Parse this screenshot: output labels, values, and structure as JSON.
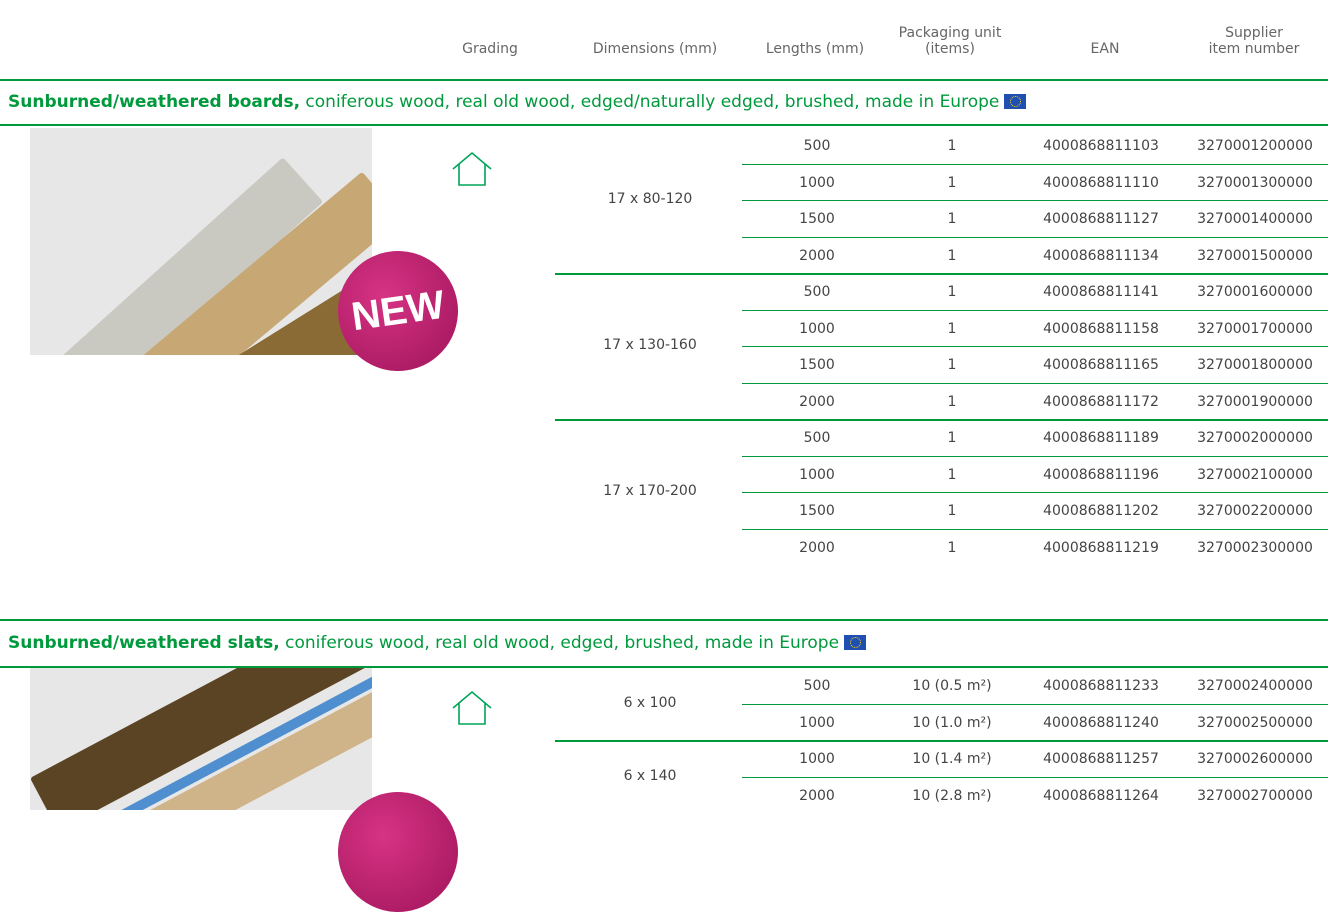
{
  "header": {
    "grading": "Grading",
    "dimensions": "Dimensions (mm)",
    "lengths": "Lengths (mm)",
    "packaging_line1": "Packaging unit",
    "packaging_line2": "(items)",
    "ean": "EAN",
    "supplier_line1": "Supplier",
    "supplier_line2": "item number"
  },
  "sections": [
    {
      "title_bold": "Sunburned/weathered boards,",
      "title_rest": " coniferous wood, real old wood, edged/naturally edged, brushed, made in Europe",
      "badge": "NEW",
      "groups": [
        {
          "dimension": "17 x 80-120",
          "rows": [
            {
              "length": "500",
              "pack": "1",
              "ean": "4000868811103",
              "supplier": "3270001200000"
            },
            {
              "length": "1000",
              "pack": "1",
              "ean": "4000868811110",
              "supplier": "3270001300000"
            },
            {
              "length": "1500",
              "pack": "1",
              "ean": "4000868811127",
              "supplier": "3270001400000"
            },
            {
              "length": "2000",
              "pack": "1",
              "ean": "4000868811134",
              "supplier": "3270001500000"
            }
          ]
        },
        {
          "dimension": "17 x 130-160",
          "rows": [
            {
              "length": "500",
              "pack": "1",
              "ean": "4000868811141",
              "supplier": "3270001600000"
            },
            {
              "length": "1000",
              "pack": "1",
              "ean": "4000868811158",
              "supplier": "3270001700000"
            },
            {
              "length": "1500",
              "pack": "1",
              "ean": "4000868811165",
              "supplier": "3270001800000"
            },
            {
              "length": "2000",
              "pack": "1",
              "ean": "4000868811172",
              "supplier": "3270001900000"
            }
          ]
        },
        {
          "dimension": "17 x 170-200",
          "rows": [
            {
              "length": "500",
              "pack": "1",
              "ean": "4000868811189",
              "supplier": "3270002000000"
            },
            {
              "length": "1000",
              "pack": "1",
              "ean": "4000868811196",
              "supplier": "3270002100000"
            },
            {
              "length": "1500",
              "pack": "1",
              "ean": "4000868811202",
              "supplier": "3270002200000"
            },
            {
              "length": "2000",
              "pack": "1",
              "ean": "4000868811219",
              "supplier": "3270002300000"
            }
          ]
        }
      ]
    },
    {
      "title_bold": "Sunburned/weathered slats,",
      "title_rest": " coniferous wood, real old wood, edged, brushed, made in Europe",
      "groups": [
        {
          "dimension": "6 x 100",
          "rows": [
            {
              "length": "500",
              "pack": "10 (0.5 m²)",
              "ean": "4000868811233",
              "supplier": "3270002400000"
            },
            {
              "length": "1000",
              "pack": "10 (1.0 m²)",
              "ean": "4000868811240",
              "supplier": "3270002500000"
            }
          ]
        },
        {
          "dimension": "6 x 140",
          "rows": [
            {
              "length": "1000",
              "pack": "10 (1.4 m²)",
              "ean": "4000868811257",
              "supplier": "3270002600000"
            },
            {
              "length": "2000",
              "pack": "10 (2.8 m²)",
              "ean": "4000868811264",
              "supplier": "3270002700000"
            }
          ]
        }
      ]
    }
  ]
}
